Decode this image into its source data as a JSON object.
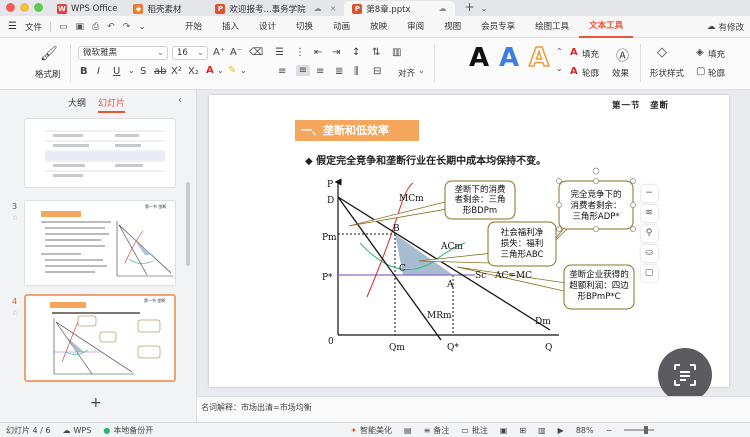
{
  "window": {
    "tabs": [
      {
        "label": "WPS Office",
        "icon": "wps-logo-icon"
      },
      {
        "label": "稻壳素材",
        "icon": "docer-icon"
      },
      {
        "label": "欢迎报考...事务学院",
        "icon": "ppt-icon"
      },
      {
        "label": "第8章.pptx",
        "icon": "ppt-icon"
      }
    ],
    "new_tab": "+"
  },
  "menubar": {
    "file": "文件",
    "items": [
      "开始",
      "插入",
      "设计",
      "切换",
      "动画",
      "放映",
      "审阅",
      "视图",
      "会员专享",
      "绘图工具",
      "文本工具"
    ],
    "active": "文本工具",
    "right": "有修改"
  },
  "ribbon": {
    "format_painter": "格式刷",
    "font_name": "微软雅黑",
    "font_size": "16",
    "arrange": "对齐",
    "fill": "填充",
    "outline": "轮廓",
    "effects": "效果",
    "shape_style": "形状样式",
    "fill2": "填充",
    "outline2": "轮廓",
    "text_style_letters": [
      "A",
      "A",
      "A"
    ]
  },
  "left_panel": {
    "tab_outline": "大纲",
    "tab_slides": "幻灯片",
    "slide_numbers": [
      "3",
      "4"
    ],
    "thumb3_title": "第一节 垄断",
    "thumb4_title": "第一节 垄断",
    "add": "+"
  },
  "slide": {
    "header": "第一节　垄断",
    "section_title": "一、垄断和低效率",
    "bullet": "◆ 假定完全竞争和垄断行业在长期中成本均保持不变。",
    "callouts": {
      "monopoly_cs": [
        "垄断下的消费",
        "者剩余：三角",
        "形BDPm"
      ],
      "welfare_loss": [
        "社会福利净",
        "损失：福利",
        "三角形ABC"
      ],
      "comp_cs": [
        "完全竞争下的",
        "消费者剩余：",
        "三角形ADP*"
      ],
      "excess_profit": [
        "垄断企业获得的",
        "超额利润：四边",
        "形BPmP*C"
      ]
    },
    "labels": {
      "P": "P",
      "D": "D",
      "Pm": "Pm",
      "Pstar": "P*",
      "origin": "0",
      "Qm": "Qm",
      "Qstar": "Q*",
      "Q": "Q",
      "MCm": "MCm",
      "ACm": "ACm",
      "Sc": "Sc",
      "ACeqMC": "AC=MC",
      "MRm": "MRm",
      "Dm": "Dm",
      "A": "A",
      "B": "B",
      "C": "C"
    }
  },
  "notes": "名词解释：市场出清=市场均衡",
  "statusbar": {
    "slide_pos": "幻灯片 4 / 6",
    "wps": "WPS",
    "backup": "本地备份开",
    "beautify": "智能美化",
    "notes": "备注",
    "comments": "批注",
    "zoom": "88%"
  },
  "colors": {
    "accent": "#e6553a",
    "section_bg": "#f4a65c",
    "triangle_fill": "#9db4cc",
    "mc_curve": "#d62828",
    "ac_curve": "#2bb673",
    "sc_line": "#8c6bc8",
    "callout_border": "#8a6d1f"
  }
}
